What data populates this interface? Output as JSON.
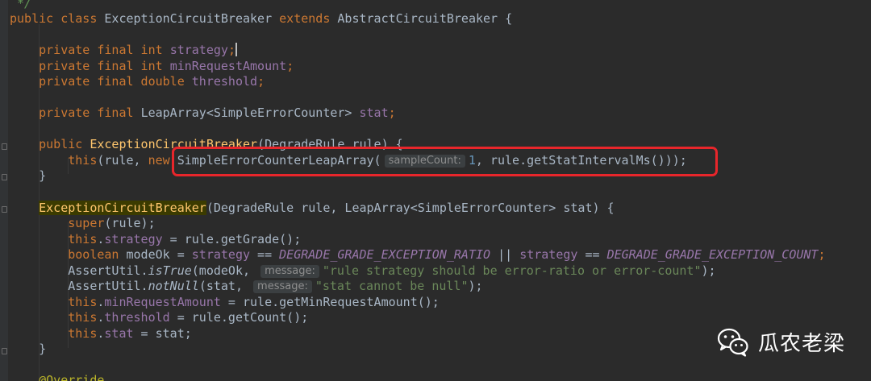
{
  "code": {
    "line_comment": " */",
    "class_decl": {
      "kw_public": "public",
      "kw_class": "class",
      "name": "ExceptionCircuitBreaker",
      "kw_extends": "extends",
      "super": "AbstractCircuitBreaker",
      "brace": " {"
    },
    "f1": {
      "mods": "private final int",
      "name": "strategy",
      "end": ";"
    },
    "f2": {
      "mods": "private final int",
      "name": "minRequestAmount",
      "end": ";"
    },
    "f3": {
      "mods": "private final double",
      "name": "threshold",
      "end": ";"
    },
    "f4": {
      "mods": "private final",
      "type": "LeapArray<SimpleErrorCounter>",
      "name": "stat",
      "end": ";"
    },
    "c1": {
      "kw": "public",
      "name": "ExceptionCircuitBreaker",
      "params": "(DegradeRule rule) {"
    },
    "c1_body": {
      "kw_this": "this",
      "args_open": "(rule, ",
      "kw_new": "new",
      "call": "SimpleErrorCounterLeapArray(",
      "hint": "sampleCount:",
      "num": "1",
      "rest": ", rule.getStatIntervalMs()));"
    },
    "close_brace": "}",
    "c2": {
      "name": "ExceptionCircuitBreaker",
      "params": "(DegradeRule rule, LeapArray<SimpleErrorCounter> stat) {"
    },
    "b1": {
      "kw": "super",
      "rest": "(rule);"
    },
    "b2": {
      "kw": "this",
      "field": "strategy",
      "rest": " = rule.getGrade();"
    },
    "b3": {
      "kw": "boolean",
      "mid": " modeOk = ",
      "field1": "strategy",
      "eq1": " == ",
      "const1": "DEGRADE_GRADE_EXCEPTION_RATIO",
      "or": " || ",
      "field2": "strategy",
      "eq2": " == ",
      "const2": "DEGRADE_GRADE_EXCEPTION_COUNT",
      "end": ";"
    },
    "b4": {
      "pre": "AssertUtil.",
      "method": "isTrue",
      "args": "(modeOk, ",
      "hint": "message:",
      "str": "\"rule strategy should be error-ratio or error-count\"",
      "end": ");"
    },
    "b5": {
      "pre": "AssertUtil.",
      "method": "notNull",
      "args": "(stat, ",
      "hint": "message:",
      "str": "\"stat cannot be null\"",
      "end": ");"
    },
    "b6": {
      "kw": "this",
      "field": "minRequestAmount",
      "rest": " = rule.getMinRequestAmount();"
    },
    "b7": {
      "kw": "this",
      "field": "threshold",
      "rest": " = rule.getCount();"
    },
    "b8": {
      "kw": "this",
      "field": "stat",
      "rest": " = stat;"
    },
    "annotation": "@Override"
  },
  "watermark": {
    "text": "瓜农老梁",
    "icon": "wechat-icon"
  },
  "colors": {
    "highlight_box": "#e8262b",
    "background": "#2b2b2b"
  }
}
